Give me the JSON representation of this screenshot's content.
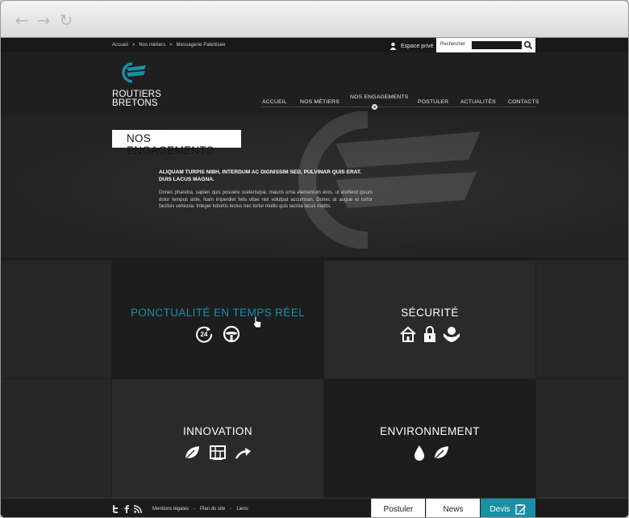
{
  "breadcrumb": {
    "items": [
      "Accueil",
      ">",
      "Nos métiers",
      ">",
      "Messagerie Palettisée"
    ]
  },
  "utility": {
    "espace_prive": "Espace privé",
    "search_label": "Rechercher"
  },
  "logo": {
    "line1": "ROUTIERS",
    "line2": "BRETONS"
  },
  "menu": {
    "items": [
      "ACCUEIL",
      "NOS MÉTIERS",
      "NOS ENGAGEMENTS",
      "POSTULER",
      "ACTUALITÉS",
      "CONTACTS"
    ],
    "active": "NOS ENGAGEMENTS"
  },
  "hero": {
    "title": "NOS ENGAGEMENTS",
    "lead": "ALIQUAM TURPIS NIBH, INTERDUM AC DIGNISSIM SED, PULVINAR QUIS ERAT. DUIS LACUS MAGNA.",
    "body": "Donec pharetra, sapien quis posuere scelerisque, mauris urna elementum eros, ut eleifend ipsum dolor tempus ante. Nam imperdiet felis vitae nisl volutpat accumsan. Donec at augue et tortor facilisis vehicula. Integer lobortis lectus nec tortor mollis quis lacinia lacus mattis."
  },
  "tiles": {
    "ponctualite": {
      "title": "PONCTUALITÉ EN TEMPS RÉEL",
      "icons": [
        "clock-24-icon",
        "steering-wheel-icon"
      ]
    },
    "securite": {
      "title": "SÉCURITÉ",
      "icons": [
        "house-icon",
        "padlock-icon",
        "hands-globe-icon"
      ]
    },
    "innovation": {
      "title": "INNOVATION",
      "icons": [
        "leaf-icon",
        "map-icon",
        "curved-arrow-icon"
      ]
    },
    "environnement": {
      "title": "ENVIRONNEMENT",
      "icons": [
        "water-drop-icon",
        "leaf-icon"
      ]
    }
  },
  "footer": {
    "social": [
      "twitter-icon",
      "facebook-icon",
      "rss-icon"
    ],
    "links": [
      "Mentions légales",
      "-",
      "Plan du site",
      "-",
      "Liens"
    ],
    "buttons": {
      "postuler": "Postuler",
      "news": "News",
      "devis": "Devis"
    }
  },
  "colors": {
    "accent": "#1b8fa3",
    "background": "#1e1e1e",
    "tile_light": "#2a2a2a",
    "tile_dark": "#1d1d1d"
  }
}
